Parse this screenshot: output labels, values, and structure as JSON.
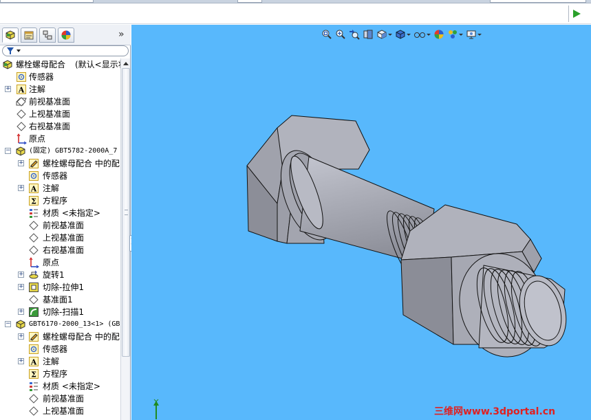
{
  "feature_tree": {
    "root": {
      "label": "螺栓螺母配合",
      "suffix": "(默认<显示状"
    },
    "items": [
      {
        "label": "传感器"
      },
      {
        "label": "注解"
      },
      {
        "label": "前视基准面"
      },
      {
        "label": "上视基准面"
      },
      {
        "label": "右视基准面"
      },
      {
        "label": "原点"
      },
      {
        "label": "(固定) GBT5782-2000A_7"
      },
      {
        "label": "螺栓螺母配合 中的配"
      },
      {
        "label": "传感器"
      },
      {
        "label": "注解"
      },
      {
        "label": "方程序"
      },
      {
        "label": "材质 <未指定>"
      },
      {
        "label": "前视基准面"
      },
      {
        "label": "上视基准面"
      },
      {
        "label": "右视基准面"
      },
      {
        "label": "原点"
      },
      {
        "label": "旋转1"
      },
      {
        "label": "切除-拉伸1"
      },
      {
        "label": "基准面1"
      },
      {
        "label": "切除-扫描1"
      },
      {
        "label": "GBT6170-2000_13<1> (GB"
      },
      {
        "label": "螺栓螺母配合 中的配"
      },
      {
        "label": "传感器"
      },
      {
        "label": "注解"
      },
      {
        "label": "方程序"
      },
      {
        "label": "材质 <未指定>"
      },
      {
        "label": "前视基准面"
      },
      {
        "label": "上视基准面"
      }
    ]
  },
  "panel_tabs": [
    "featuremanager-tab",
    "propertymanager-tab",
    "configurationmanager-tab",
    "appearance-tab"
  ],
  "heads_up_toolbar": [
    "zoom-to-fit-icon",
    "zoom-to-area-icon",
    "previous-view-icon",
    "section-view-icon",
    "view-orientation-icon",
    "display-style-icon",
    "hide-show-items-icon",
    "edit-appearance-icon",
    "apply-scene-icon",
    "view-settings-icon"
  ],
  "watermark": "三维网www.3dportal.cn",
  "colors": {
    "viewport_bg": "#58b8fc",
    "model_face": "#a9abb4",
    "watermark": "#e02020"
  }
}
